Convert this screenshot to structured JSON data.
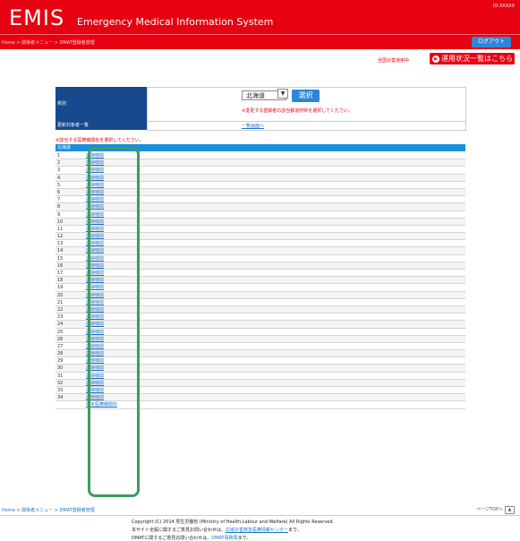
{
  "header": {
    "logo": "EMIS",
    "subtitle": "Emergency Medical Information System",
    "top_tag": "ID:XXXXX",
    "crumb_home": "Home",
    "crumb_sep": " > ",
    "crumb_menu": "関係者メニュー",
    "crumb_page": "DMAT登録者管理",
    "logout_label": "ログアウト"
  },
  "alert": {
    "status_label": "全国災害運用中",
    "ops_button": "運用状況一覧はこちら"
  },
  "form": {
    "pref_label": "県別",
    "pref_value": "北海道",
    "select_button": "選択",
    "pref_note": "※変更する登録者の該当都道府県を選択してください。",
    "list_label": "更新対象者一覧",
    "list_link": "一覧画面へ"
  },
  "hospital_list": {
    "instruction": "※該当する医療機関名を選択してください。",
    "column_header": "北海道",
    "rows": [
      {
        "num": "1",
        "name": "試験機関"
      },
      {
        "num": "2",
        "name": "試験機関"
      },
      {
        "num": "3",
        "name": "試験機関"
      },
      {
        "num": "4",
        "name": "試験機関"
      },
      {
        "num": "5",
        "name": "試験機関"
      },
      {
        "num": "6",
        "name": "試験機関"
      },
      {
        "num": "7",
        "name": "試験機関"
      },
      {
        "num": "8",
        "name": "試験機関"
      },
      {
        "num": "9",
        "name": "試験機関"
      },
      {
        "num": "10",
        "name": "試験機関"
      },
      {
        "num": "11",
        "name": "試験機関"
      },
      {
        "num": "12",
        "name": "試験機関"
      },
      {
        "num": "13",
        "name": "試験機関"
      },
      {
        "num": "14",
        "name": "試験機関"
      },
      {
        "num": "15",
        "name": "試験機関"
      },
      {
        "num": "16",
        "name": "試験機関"
      },
      {
        "num": "17",
        "name": "試験機関"
      },
      {
        "num": "18",
        "name": "試験機関"
      },
      {
        "num": "19",
        "name": "試験機関"
      },
      {
        "num": "20",
        "name": "試験機関"
      },
      {
        "num": "21",
        "name": "試験機関"
      },
      {
        "num": "22",
        "name": "試験機関"
      },
      {
        "num": "23",
        "name": "試験機関"
      },
      {
        "num": "24",
        "name": "試験機関"
      },
      {
        "num": "25",
        "name": "試験機関"
      },
      {
        "num": "26",
        "name": "試験機関"
      },
      {
        "num": "27",
        "name": "試験機関"
      },
      {
        "num": "28",
        "name": "試験機関"
      },
      {
        "num": "29",
        "name": "試験機関"
      },
      {
        "num": "30",
        "name": "試験機関"
      },
      {
        "num": "31",
        "name": "試験機関"
      },
      {
        "num": "32",
        "name": "試験機関"
      },
      {
        "num": "33",
        "name": "試験機関"
      },
      {
        "num": "34",
        "name": "試験機関"
      },
      {
        "num": "",
        "name": "指定医療機関外"
      }
    ]
  },
  "footer": {
    "crumb_home": "Home",
    "crumb_menu": "関係者メニュー",
    "crumb_page": "DMAT登録者管理",
    "page_top": "ページTOPへ",
    "copyright": "Copyright (C) 2014 厚生労働省 (Ministry of Health,Labour and Welfare) All Rights Reserved.",
    "inquiry_prefix": "本サイト全般に関するご意見お問い合わせは、",
    "inquiry_link": "広域災害救急医療情報センター",
    "inquiry_suffix": "まで。",
    "inquiry2_prefix": "DMATに関するご意見お問い合わせは、",
    "inquiry2_link": "DMAT事務局",
    "inquiry2_suffix": "まで。"
  },
  "colors": {
    "brand_red": "#e60012",
    "navy_label": "#16498e",
    "blue_button": "#2f86d8",
    "list_header_blue": "#1b8fdc",
    "highlight_green": "#3a9e5c"
  }
}
